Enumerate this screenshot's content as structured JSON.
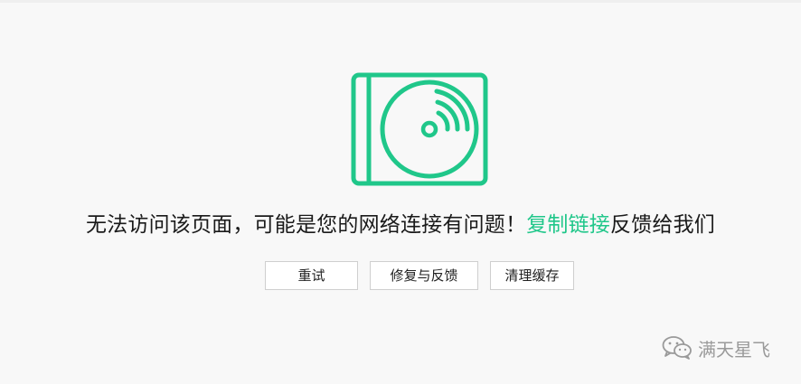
{
  "message": {
    "text_before": "无法访问该页面，可能是您的网络连接有问题！",
    "link_text": "复制链接",
    "text_after": "反馈给我们"
  },
  "buttons": {
    "retry": "重试",
    "feedback": "修复与反馈",
    "clear_cache": "清理缓存"
  },
  "watermark": {
    "text": "满天星飞",
    "icon": "wechat-icon"
  },
  "colors": {
    "accent": "#20c78a",
    "background": "#f8f8f8",
    "watermark": "#9a9a9a"
  }
}
